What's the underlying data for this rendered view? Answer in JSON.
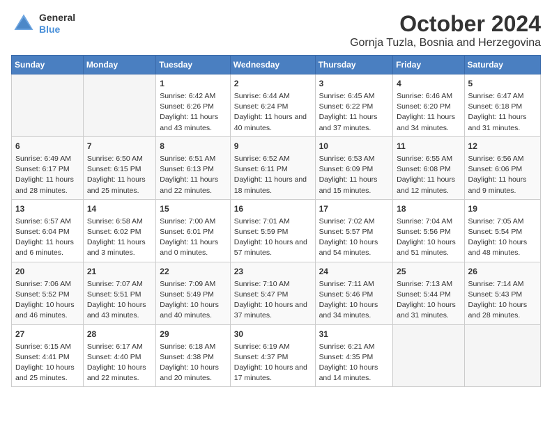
{
  "header": {
    "logo_line1": "General",
    "logo_line2": "Blue",
    "title": "October 2024",
    "subtitle": "Gornja Tuzla, Bosnia and Herzegovina"
  },
  "days_of_week": [
    "Sunday",
    "Monday",
    "Tuesday",
    "Wednesday",
    "Thursday",
    "Friday",
    "Saturday"
  ],
  "weeks": [
    [
      {
        "day": "",
        "content": ""
      },
      {
        "day": "",
        "content": ""
      },
      {
        "day": "1",
        "content": "Sunrise: 6:42 AM\nSunset: 6:26 PM\nDaylight: 11 hours and 43 minutes."
      },
      {
        "day": "2",
        "content": "Sunrise: 6:44 AM\nSunset: 6:24 PM\nDaylight: 11 hours and 40 minutes."
      },
      {
        "day": "3",
        "content": "Sunrise: 6:45 AM\nSunset: 6:22 PM\nDaylight: 11 hours and 37 minutes."
      },
      {
        "day": "4",
        "content": "Sunrise: 6:46 AM\nSunset: 6:20 PM\nDaylight: 11 hours and 34 minutes."
      },
      {
        "day": "5",
        "content": "Sunrise: 6:47 AM\nSunset: 6:18 PM\nDaylight: 11 hours and 31 minutes."
      }
    ],
    [
      {
        "day": "6",
        "content": "Sunrise: 6:49 AM\nSunset: 6:17 PM\nDaylight: 11 hours and 28 minutes."
      },
      {
        "day": "7",
        "content": "Sunrise: 6:50 AM\nSunset: 6:15 PM\nDaylight: 11 hours and 25 minutes."
      },
      {
        "day": "8",
        "content": "Sunrise: 6:51 AM\nSunset: 6:13 PM\nDaylight: 11 hours and 22 minutes."
      },
      {
        "day": "9",
        "content": "Sunrise: 6:52 AM\nSunset: 6:11 PM\nDaylight: 11 hours and 18 minutes."
      },
      {
        "day": "10",
        "content": "Sunrise: 6:53 AM\nSunset: 6:09 PM\nDaylight: 11 hours and 15 minutes."
      },
      {
        "day": "11",
        "content": "Sunrise: 6:55 AM\nSunset: 6:08 PM\nDaylight: 11 hours and 12 minutes."
      },
      {
        "day": "12",
        "content": "Sunrise: 6:56 AM\nSunset: 6:06 PM\nDaylight: 11 hours and 9 minutes."
      }
    ],
    [
      {
        "day": "13",
        "content": "Sunrise: 6:57 AM\nSunset: 6:04 PM\nDaylight: 11 hours and 6 minutes."
      },
      {
        "day": "14",
        "content": "Sunrise: 6:58 AM\nSunset: 6:02 PM\nDaylight: 11 hours and 3 minutes."
      },
      {
        "day": "15",
        "content": "Sunrise: 7:00 AM\nSunset: 6:01 PM\nDaylight: 11 hours and 0 minutes."
      },
      {
        "day": "16",
        "content": "Sunrise: 7:01 AM\nSunset: 5:59 PM\nDaylight: 10 hours and 57 minutes."
      },
      {
        "day": "17",
        "content": "Sunrise: 7:02 AM\nSunset: 5:57 PM\nDaylight: 10 hours and 54 minutes."
      },
      {
        "day": "18",
        "content": "Sunrise: 7:04 AM\nSunset: 5:56 PM\nDaylight: 10 hours and 51 minutes."
      },
      {
        "day": "19",
        "content": "Sunrise: 7:05 AM\nSunset: 5:54 PM\nDaylight: 10 hours and 48 minutes."
      }
    ],
    [
      {
        "day": "20",
        "content": "Sunrise: 7:06 AM\nSunset: 5:52 PM\nDaylight: 10 hours and 46 minutes."
      },
      {
        "day": "21",
        "content": "Sunrise: 7:07 AM\nSunset: 5:51 PM\nDaylight: 10 hours and 43 minutes."
      },
      {
        "day": "22",
        "content": "Sunrise: 7:09 AM\nSunset: 5:49 PM\nDaylight: 10 hours and 40 minutes."
      },
      {
        "day": "23",
        "content": "Sunrise: 7:10 AM\nSunset: 5:47 PM\nDaylight: 10 hours and 37 minutes."
      },
      {
        "day": "24",
        "content": "Sunrise: 7:11 AM\nSunset: 5:46 PM\nDaylight: 10 hours and 34 minutes."
      },
      {
        "day": "25",
        "content": "Sunrise: 7:13 AM\nSunset: 5:44 PM\nDaylight: 10 hours and 31 minutes."
      },
      {
        "day": "26",
        "content": "Sunrise: 7:14 AM\nSunset: 5:43 PM\nDaylight: 10 hours and 28 minutes."
      }
    ],
    [
      {
        "day": "27",
        "content": "Sunrise: 6:15 AM\nSunset: 4:41 PM\nDaylight: 10 hours and 25 minutes."
      },
      {
        "day": "28",
        "content": "Sunrise: 6:17 AM\nSunset: 4:40 PM\nDaylight: 10 hours and 22 minutes."
      },
      {
        "day": "29",
        "content": "Sunrise: 6:18 AM\nSunset: 4:38 PM\nDaylight: 10 hours and 20 minutes."
      },
      {
        "day": "30",
        "content": "Sunrise: 6:19 AM\nSunset: 4:37 PM\nDaylight: 10 hours and 17 minutes."
      },
      {
        "day": "31",
        "content": "Sunrise: 6:21 AM\nSunset: 4:35 PM\nDaylight: 10 hours and 14 minutes."
      },
      {
        "day": "",
        "content": ""
      },
      {
        "day": "",
        "content": ""
      }
    ]
  ]
}
